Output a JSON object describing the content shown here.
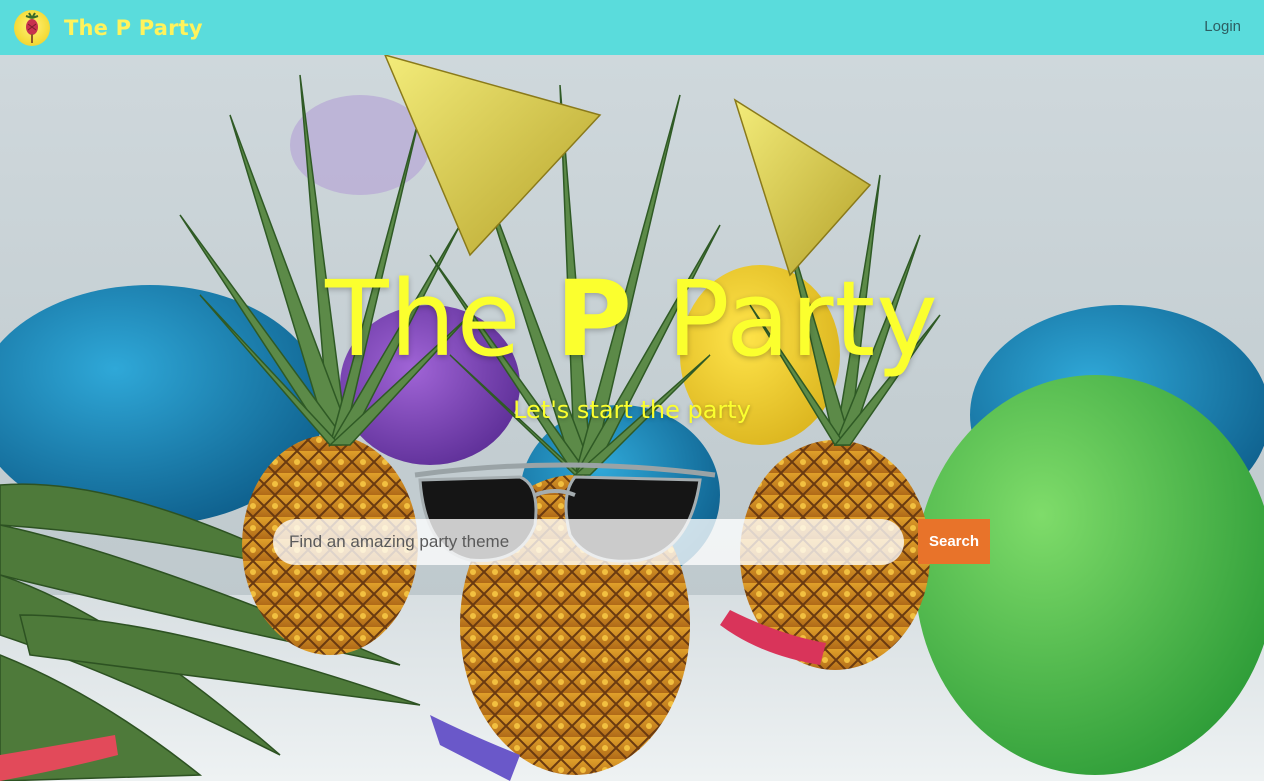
{
  "navbar": {
    "brand_name": "The P Party",
    "login_label": "Login",
    "logo_icon": "pineapple-logo-icon",
    "background_color": "#5adcdc"
  },
  "hero": {
    "title_part1": "The ",
    "title_bold": "P",
    "title_part2": " Party",
    "tagline": "Let's start the party",
    "title_color": "#fbff2e"
  },
  "search": {
    "placeholder": "Find an amazing party theme",
    "value": "",
    "button_label": "Search",
    "button_color": "#e8732a"
  }
}
